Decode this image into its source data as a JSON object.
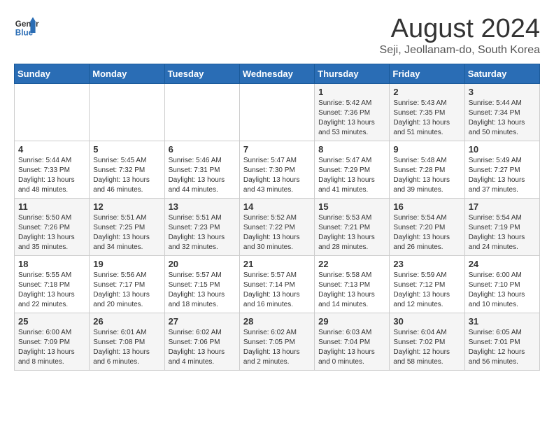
{
  "header": {
    "logo_line1": "General",
    "logo_line2": "Blue",
    "month": "August 2024",
    "location": "Seji, Jeollanam-do, South Korea"
  },
  "weekdays": [
    "Sunday",
    "Monday",
    "Tuesday",
    "Wednesday",
    "Thursday",
    "Friday",
    "Saturday"
  ],
  "weeks": [
    [
      {
        "day": "",
        "content": ""
      },
      {
        "day": "",
        "content": ""
      },
      {
        "day": "",
        "content": ""
      },
      {
        "day": "",
        "content": ""
      },
      {
        "day": "1",
        "content": "Sunrise: 5:42 AM\nSunset: 7:36 PM\nDaylight: 13 hours\nand 53 minutes."
      },
      {
        "day": "2",
        "content": "Sunrise: 5:43 AM\nSunset: 7:35 PM\nDaylight: 13 hours\nand 51 minutes."
      },
      {
        "day": "3",
        "content": "Sunrise: 5:44 AM\nSunset: 7:34 PM\nDaylight: 13 hours\nand 50 minutes."
      }
    ],
    [
      {
        "day": "4",
        "content": "Sunrise: 5:44 AM\nSunset: 7:33 PM\nDaylight: 13 hours\nand 48 minutes."
      },
      {
        "day": "5",
        "content": "Sunrise: 5:45 AM\nSunset: 7:32 PM\nDaylight: 13 hours\nand 46 minutes."
      },
      {
        "day": "6",
        "content": "Sunrise: 5:46 AM\nSunset: 7:31 PM\nDaylight: 13 hours\nand 44 minutes."
      },
      {
        "day": "7",
        "content": "Sunrise: 5:47 AM\nSunset: 7:30 PM\nDaylight: 13 hours\nand 43 minutes."
      },
      {
        "day": "8",
        "content": "Sunrise: 5:47 AM\nSunset: 7:29 PM\nDaylight: 13 hours\nand 41 minutes."
      },
      {
        "day": "9",
        "content": "Sunrise: 5:48 AM\nSunset: 7:28 PM\nDaylight: 13 hours\nand 39 minutes."
      },
      {
        "day": "10",
        "content": "Sunrise: 5:49 AM\nSunset: 7:27 PM\nDaylight: 13 hours\nand 37 minutes."
      }
    ],
    [
      {
        "day": "11",
        "content": "Sunrise: 5:50 AM\nSunset: 7:26 PM\nDaylight: 13 hours\nand 35 minutes."
      },
      {
        "day": "12",
        "content": "Sunrise: 5:51 AM\nSunset: 7:25 PM\nDaylight: 13 hours\nand 34 minutes."
      },
      {
        "day": "13",
        "content": "Sunrise: 5:51 AM\nSunset: 7:23 PM\nDaylight: 13 hours\nand 32 minutes."
      },
      {
        "day": "14",
        "content": "Sunrise: 5:52 AM\nSunset: 7:22 PM\nDaylight: 13 hours\nand 30 minutes."
      },
      {
        "day": "15",
        "content": "Sunrise: 5:53 AM\nSunset: 7:21 PM\nDaylight: 13 hours\nand 28 minutes."
      },
      {
        "day": "16",
        "content": "Sunrise: 5:54 AM\nSunset: 7:20 PM\nDaylight: 13 hours\nand 26 minutes."
      },
      {
        "day": "17",
        "content": "Sunrise: 5:54 AM\nSunset: 7:19 PM\nDaylight: 13 hours\nand 24 minutes."
      }
    ],
    [
      {
        "day": "18",
        "content": "Sunrise: 5:55 AM\nSunset: 7:18 PM\nDaylight: 13 hours\nand 22 minutes."
      },
      {
        "day": "19",
        "content": "Sunrise: 5:56 AM\nSunset: 7:17 PM\nDaylight: 13 hours\nand 20 minutes."
      },
      {
        "day": "20",
        "content": "Sunrise: 5:57 AM\nSunset: 7:15 PM\nDaylight: 13 hours\nand 18 minutes."
      },
      {
        "day": "21",
        "content": "Sunrise: 5:57 AM\nSunset: 7:14 PM\nDaylight: 13 hours\nand 16 minutes."
      },
      {
        "day": "22",
        "content": "Sunrise: 5:58 AM\nSunset: 7:13 PM\nDaylight: 13 hours\nand 14 minutes."
      },
      {
        "day": "23",
        "content": "Sunrise: 5:59 AM\nSunset: 7:12 PM\nDaylight: 13 hours\nand 12 minutes."
      },
      {
        "day": "24",
        "content": "Sunrise: 6:00 AM\nSunset: 7:10 PM\nDaylight: 13 hours\nand 10 minutes."
      }
    ],
    [
      {
        "day": "25",
        "content": "Sunrise: 6:00 AM\nSunset: 7:09 PM\nDaylight: 13 hours\nand 8 minutes."
      },
      {
        "day": "26",
        "content": "Sunrise: 6:01 AM\nSunset: 7:08 PM\nDaylight: 13 hours\nand 6 minutes."
      },
      {
        "day": "27",
        "content": "Sunrise: 6:02 AM\nSunset: 7:06 PM\nDaylight: 13 hours\nand 4 minutes."
      },
      {
        "day": "28",
        "content": "Sunrise: 6:02 AM\nSunset: 7:05 PM\nDaylight: 13 hours\nand 2 minutes."
      },
      {
        "day": "29",
        "content": "Sunrise: 6:03 AM\nSunset: 7:04 PM\nDaylight: 13 hours\nand 0 minutes."
      },
      {
        "day": "30",
        "content": "Sunrise: 6:04 AM\nSunset: 7:02 PM\nDaylight: 12 hours\nand 58 minutes."
      },
      {
        "day": "31",
        "content": "Sunrise: 6:05 AM\nSunset: 7:01 PM\nDaylight: 12 hours\nand 56 minutes."
      }
    ]
  ]
}
